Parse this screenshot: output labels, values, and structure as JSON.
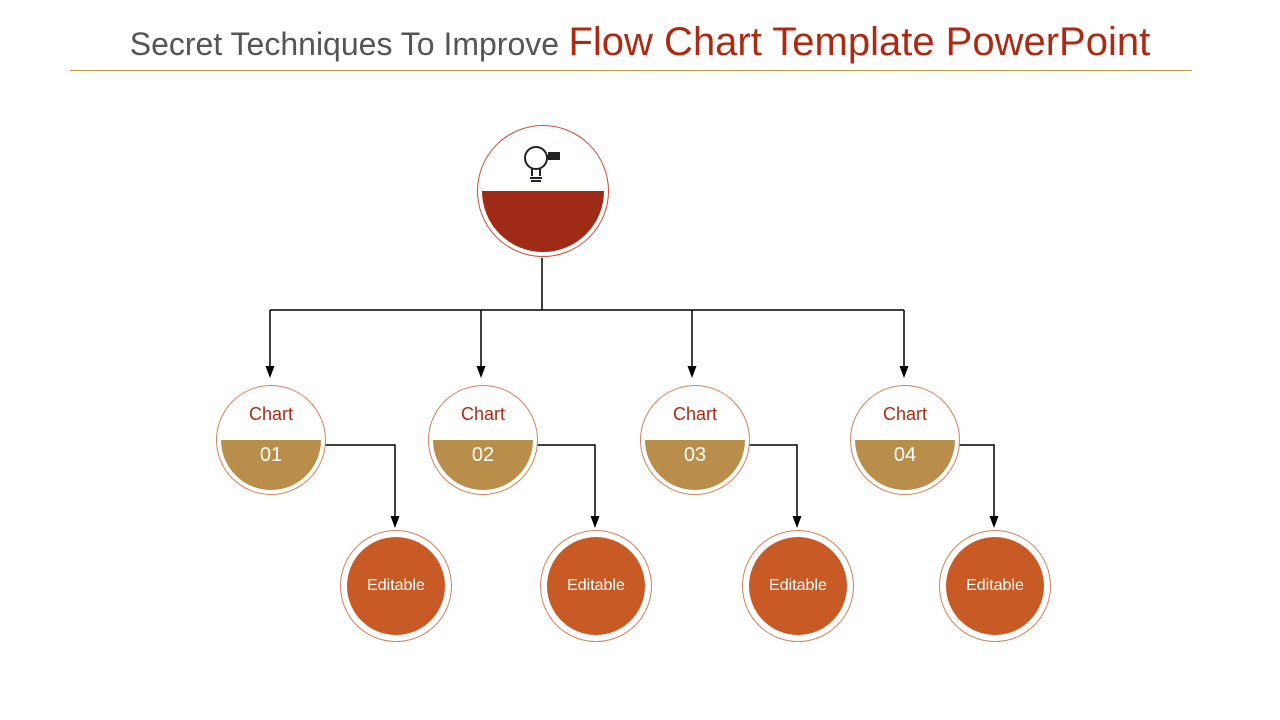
{
  "title": {
    "first": "Secret Techniques To Improve",
    "second": "Flow Chart Template PowerPoint"
  },
  "nodes": {
    "chart_label": "Chart",
    "items": [
      {
        "num": "01",
        "leaf": "Editable"
      },
      {
        "num": "02",
        "leaf": "Editable"
      },
      {
        "num": "03",
        "leaf": "Editable"
      },
      {
        "num": "04",
        "leaf": "Editable"
      }
    ]
  },
  "colors": {
    "accent_dark": "#9f2a15",
    "accent_orange": "#c85a26",
    "accent_tan": "#b88e4a",
    "underline": "#c39a3f"
  }
}
